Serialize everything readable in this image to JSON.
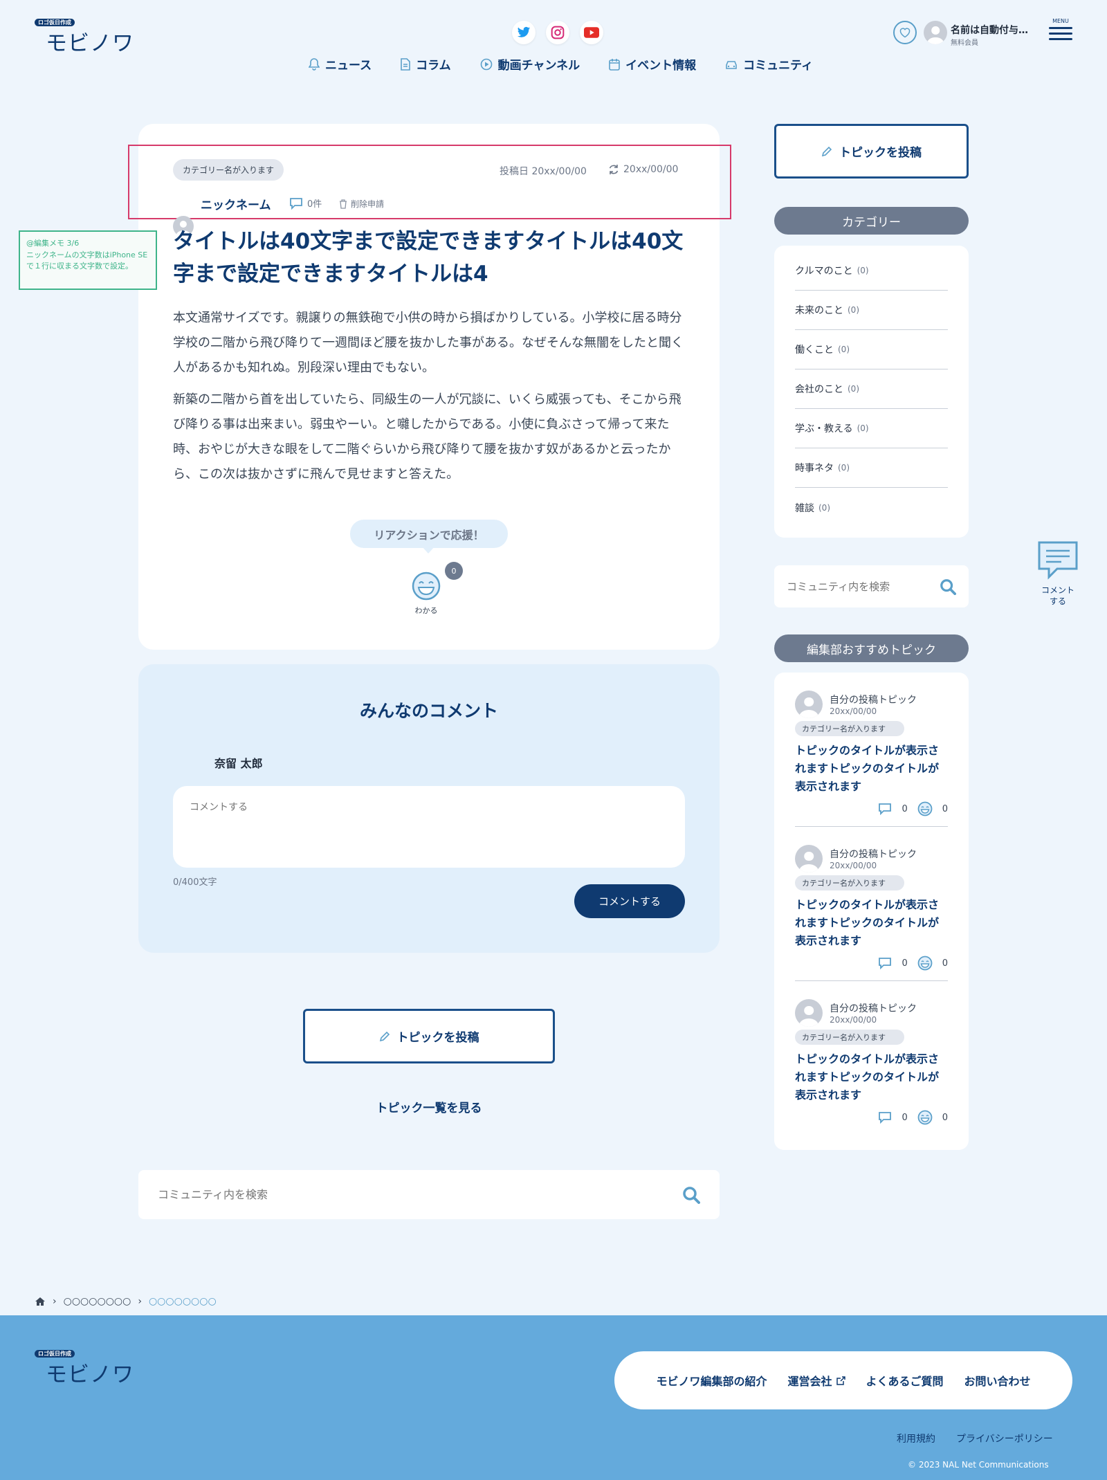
{
  "header": {
    "logo_badge": "ロゴ仮日作成",
    "logo_text": "モビノワ",
    "user_name": "名前は自動付与…",
    "user_status": "無料会員",
    "menu_label": "MENU",
    "nav": [
      {
        "label": "ニュース",
        "icon": "bell-icon"
      },
      {
        "label": "コラム",
        "icon": "document-icon"
      },
      {
        "label": "動画チャンネル",
        "icon": "play-icon"
      },
      {
        "label": "イベント情報",
        "icon": "calendar-icon"
      },
      {
        "label": "コミュニティ",
        "icon": "car-icon"
      }
    ]
  },
  "article": {
    "category": "カテゴリー名が入ります",
    "posted_label": "投稿日 20xx/00/00",
    "updated_label": "20xx/00/00",
    "nickname": "ニックネーム",
    "comment_count": "0件",
    "delete_request": "削除申請",
    "title": "タイトルは40文字まで設定できますタイトルは40文字まで設定できますタイトルは4",
    "body": [
      "本文通常サイズです。親譲りの無鉄砲で小供の時から損ばかりしている。小学校に居る時分学校の二階から飛び降りて一週間ほど腰を抜かした事がある。なぜそんな無闇をしたと聞く人があるかも知れぬ。別段深い理由でもない。",
      "新築の二階から首を出していたら、同級生の一人が冗談に、いくら威張っても、そこから飛び降りる事は出来まい。弱虫やーい。と囃したからである。小使に負ぶさって帰って来た時、おやじが大きな眼をして二階ぐらいから飛び降りて腰を抜かす奴があるかと云ったから、この次は抜かさずに飛んで見せますと答えた。"
    ],
    "reaction_prompt": "リアクションで応援！",
    "reaction_label": "わかる",
    "reaction_count": "0"
  },
  "editor_note": {
    "title": "@編集メモ 3/6",
    "text": "ニックネームの文字数はiPhone SEで１行に収まる文字数で設定。"
  },
  "comments": {
    "heading": "みんなのコメント",
    "user_name": "奈留 太郎",
    "placeholder": "コメントする",
    "char_count": "0/400文字",
    "submit": "コメントする"
  },
  "post_topic": "トピックを投稿",
  "topic_list_link": "トピック一覧を見る",
  "search_placeholder": "コミュニティ内を検索",
  "sidebar": {
    "post_topic": "トピックを投稿",
    "category_heading": "カテゴリー",
    "categories": [
      {
        "name": "クルマのこと",
        "count": "(0)"
      },
      {
        "name": "未来のこと",
        "count": "(0)"
      },
      {
        "name": "働くこと",
        "count": "(0)"
      },
      {
        "name": "会社のこと",
        "count": "(0)"
      },
      {
        "name": "学ぶ・教える",
        "count": "(0)"
      },
      {
        "name": "時事ネタ",
        "count": "(0)"
      },
      {
        "name": "雑談",
        "count": "(0)"
      }
    ],
    "search_placeholder": "コミュニティ内を検索",
    "recommend_heading": "編集部おすすめトピック",
    "recommended": [
      {
        "author": "自分の投稿トピック",
        "date": "20xx/00/00",
        "category": "カテゴリー名が入ります",
        "title": "トピックのタイトルが表示されますトピックのタイトルが表示されます",
        "comments": "0",
        "reactions": "0"
      },
      {
        "author": "自分の投稿トピック",
        "date": "20xx/00/00",
        "category": "カテゴリー名が入ります",
        "title": "トピックのタイトルが表示されますトピックのタイトルが表示されます",
        "comments": "0",
        "reactions": "0"
      },
      {
        "author": "自分の投稿トピック",
        "date": "20xx/00/00",
        "category": "カテゴリー名が入ります",
        "title": "トピックのタイトルが表示されますトピックのタイトルが表示されます",
        "comments": "0",
        "reactions": "0"
      }
    ]
  },
  "floating_comment": "コメントする",
  "breadcrumb": [
    "○○○○○○○○",
    "○○○○○○○○"
  ],
  "footer": {
    "logo_badge": "ロゴ仮日作成",
    "logo_text": "モビノワ",
    "links": [
      "モビノワ編集部の紹介",
      "運営会社",
      "よくあるご質問",
      "お問い合わせ"
    ],
    "terms": "利用規約",
    "privacy": "プライバシーポリシー",
    "copyright": "© 2023 NAL Net Communications"
  },
  "colors": {
    "primary": "#0f3a70",
    "accent_light": "#e1effb",
    "footer_bg": "#64aadc",
    "highlight": "#d63a6a",
    "note": "#3fb48a"
  }
}
